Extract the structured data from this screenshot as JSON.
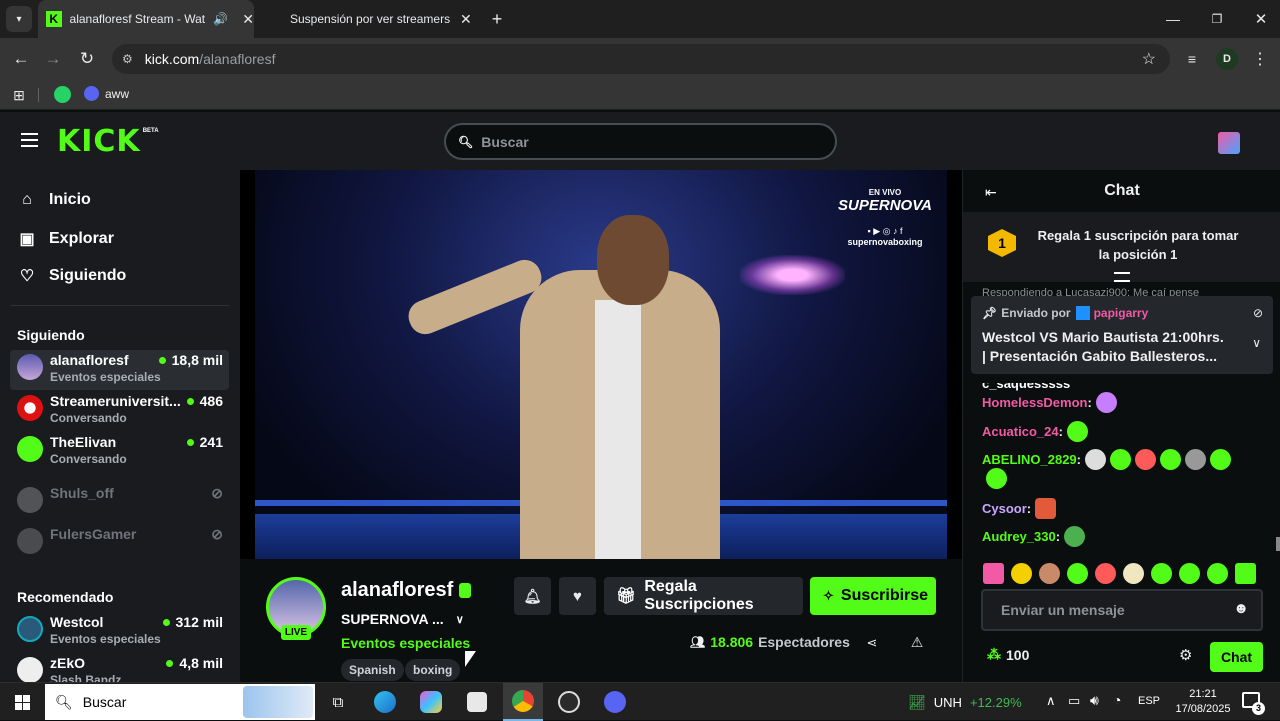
{
  "browser": {
    "tabs": [
      {
        "title": "alanafloresf Stream - Watch",
        "active": true
      },
      {
        "title": "Suspensión por ver streamers",
        "active": false
      }
    ],
    "url_domain": "kick.com",
    "url_path": "/alanafloresf",
    "profile_initial": "D",
    "bookmarks": [
      {
        "label": "aww"
      }
    ]
  },
  "kick": {
    "logo": "KICK",
    "logo_badge": "BETA",
    "search_placeholder": "Buscar",
    "nav": [
      {
        "label": "Inicio",
        "icon": "home-icon"
      },
      {
        "label": "Explorar",
        "icon": "explore-icon"
      },
      {
        "label": "Siguiendo",
        "icon": "heart-icon"
      }
    ],
    "following_title": "Siguiendo",
    "following": [
      {
        "name": "alanafloresf",
        "category": "Eventos especiales",
        "viewers": "18,8 mil",
        "live": true
      },
      {
        "name": "Streameruniversit...",
        "category": "Conversando",
        "viewers": "486",
        "live": true
      },
      {
        "name": "TheElivan",
        "category": "Conversando",
        "viewers": "241",
        "live": true
      },
      {
        "name": "Shuls_off",
        "category": "",
        "viewers": "",
        "live": false
      },
      {
        "name": "FulersGamer",
        "category": "",
        "viewers": "",
        "live": false
      }
    ],
    "recommended_title": "Recomendado",
    "recommended": [
      {
        "name": "Westcol",
        "category": "Eventos especiales",
        "viewers": "312 mil"
      },
      {
        "name": "zEkO",
        "category": "Slash Bandz",
        "viewers": "4,8 mil"
      }
    ],
    "video_overlay": {
      "line1": "EN VIVO",
      "line2": "SUPERNOVA",
      "line3": "supernovaboxing"
    },
    "streamer": {
      "name": "alanafloresf",
      "title": "SUPERNOVA ...",
      "category": "Eventos especiales",
      "live_badge": "LIVE",
      "tags": [
        "Spanish",
        "boxing"
      ],
      "gift_label": "Regala Suscripciones",
      "subscribe_label": "Suscribirse",
      "viewers_count": "18.806",
      "viewers_label": "Espectadores"
    },
    "chat": {
      "title": "Chat",
      "gift_rank": "1",
      "gift_text": "Regala 1 suscripción para tomar la posición 1",
      "reply_preview": "Respondiendo a Lucasazi900: Me caí pense",
      "pinned_label": "Enviado por",
      "pinned_by": "papigarry",
      "pinned_text": "Westcol VS Mario Bautista 21:00hrs. | Presentación Gabito Ballesteros...",
      "messages": [
        {
          "user": "c_saquesssss",
          "color": "#ffffff"
        },
        {
          "user": "HomelessDemon",
          "color": "#f25aa5"
        },
        {
          "user": "Acuatico_24",
          "color": "#f25aa5"
        },
        {
          "user": "ABELINO_2829",
          "color": "#53fc18"
        },
        {
          "user": "Cysoor",
          "color": "#c9a6ff"
        },
        {
          "user": "Audrey_330",
          "color": "#53fc18"
        }
      ],
      "input_placeholder": "Enviar un mensaje",
      "points": "100",
      "send_label": "Chat"
    }
  },
  "taskbar": {
    "search_placeholder": "Buscar",
    "stock_symbol": "UNH",
    "stock_change": "+12.29%",
    "language": "ESP",
    "time": "21:21",
    "date": "17/08/2025",
    "notifications": "3"
  },
  "colors": {
    "kick_green": "#53fc18",
    "background": "#0b0e0f",
    "panel": "#191b1f"
  }
}
